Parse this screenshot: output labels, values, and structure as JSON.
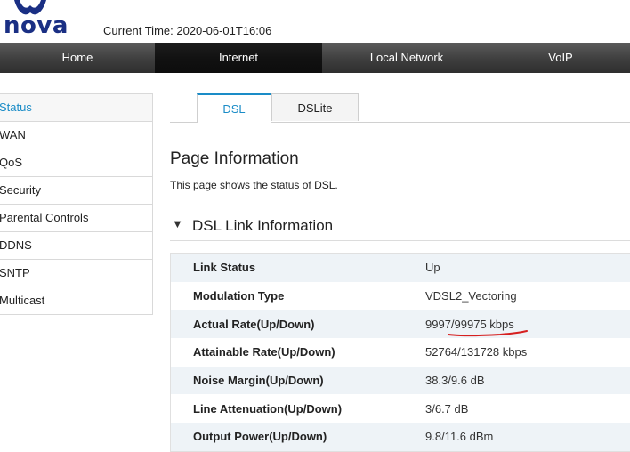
{
  "header": {
    "logo_text": "nova",
    "current_time": "Current Time: 2020-06-01T16:06"
  },
  "nav": {
    "items": [
      {
        "label": "Home"
      },
      {
        "label": "Internet"
      },
      {
        "label": "Local Network"
      },
      {
        "label": "VoIP"
      }
    ],
    "active": "Internet"
  },
  "sidebar": {
    "items": [
      {
        "label": "Status"
      },
      {
        "label": "WAN"
      },
      {
        "label": "QoS"
      },
      {
        "label": "Security"
      },
      {
        "label": "Parental Controls"
      },
      {
        "label": "DDNS"
      },
      {
        "label": "SNTP"
      },
      {
        "label": "Multicast"
      }
    ],
    "active": "Status"
  },
  "tabs": {
    "items": [
      {
        "label": "DSL"
      },
      {
        "label": "DSLite"
      }
    ],
    "active": "DSL"
  },
  "page": {
    "title": "Page Information",
    "description": "This page shows the status of DSL."
  },
  "section": {
    "arrow": "▼",
    "title": "DSL Link Information"
  },
  "dsl_info": {
    "rows": [
      {
        "label": "Link Status",
        "value": "Up"
      },
      {
        "label": "Modulation Type",
        "value": "VDSL2_Vectoring"
      },
      {
        "label": "Actual Rate(Up/Down)",
        "value": "9997/99975 kbps"
      },
      {
        "label": "Attainable Rate(Up/Down)",
        "value": "52764/131728 kbps"
      },
      {
        "label": "Noise Margin(Up/Down)",
        "value": "38.3/9.6 dB"
      },
      {
        "label": "Line Attenuation(Up/Down)",
        "value": "3/6.7 dB"
      },
      {
        "label": "Output Power(Up/Down)",
        "value": "9.8/11.6 dBm"
      }
    ]
  },
  "colors": {
    "brand": "#1a2f84",
    "accent": "#1a8cc7",
    "annotation": "#d62020"
  },
  "icons": {
    "logo": "nova-logo-icon",
    "section_toggle": "triangle-down-icon"
  }
}
